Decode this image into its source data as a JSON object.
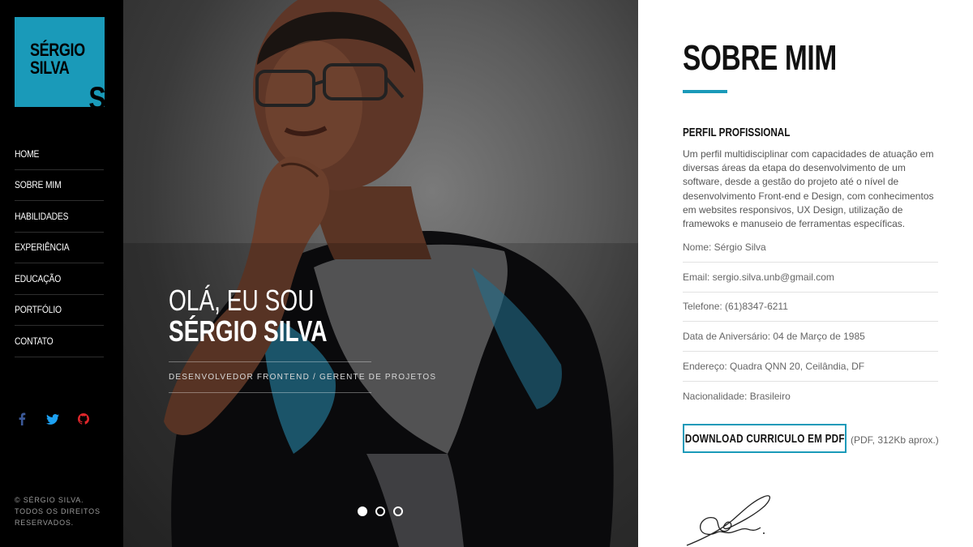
{
  "brand": {
    "line1": "SÉRGIO",
    "line2": "SILVA",
    "mark": "S",
    "color": "#1a9ab9"
  },
  "nav": {
    "items": [
      {
        "label": "HOME"
      },
      {
        "label": "SOBRE MIM"
      },
      {
        "label": "HABILIDADES"
      },
      {
        "label": "EXPERIÊNCIA"
      },
      {
        "label": "EDUCAÇÃO"
      },
      {
        "label": "PORTFÓLIO"
      },
      {
        "label": "CONTATO"
      }
    ]
  },
  "social": [
    {
      "icon": "facebook-icon",
      "color": "#3b5998"
    },
    {
      "icon": "twitter-icon",
      "color": "#1da1f2"
    },
    {
      "icon": "github-icon",
      "color": "#e0262b"
    }
  ],
  "copyright": {
    "line1": "© SÉRGIO SILVA.",
    "line2": "TODOS OS DIREITOS",
    "line3": "RESERVADOS."
  },
  "hero": {
    "greeting": "OLÁ, EU SOU",
    "name": "SÉRGIO SILVA",
    "subtitle": "DESENVOLVEDOR FRONTEND / GERENTE DE PROJETOS",
    "slides": 3,
    "active_slide": 1
  },
  "about": {
    "title": "SOBRE MIM",
    "profile_heading": "PERFIL PROFISSIONAL",
    "description": "Um perfil multidisciplinar com capacidades de atuação em diversas áreas da etapa do desenvolvimento de um software, desde a gestão do projeto até o nível de desenvolvimento Front-end e Design, com conhecimentos em websites responsivos, UX Design, utilização de framewoks e manuseio de ferramentas específicas.",
    "info": [
      {
        "text": "Nome: Sérgio Silva"
      },
      {
        "text": "Email: sergio.silva.unb@gmail.com"
      },
      {
        "text": "Telefone: (61)8347-6211"
      },
      {
        "text": "Data de Aniversário: 04 de Março de 1985"
      },
      {
        "text": "Endereço: Quadra QNN 20, Ceilândia, DF"
      },
      {
        "text": "Nacionalidade: Brasileiro"
      }
    ],
    "download_label": "DOWNLOAD CURRICULO EM PDF",
    "download_note": "(PDF, 312Kb aprox.)"
  }
}
